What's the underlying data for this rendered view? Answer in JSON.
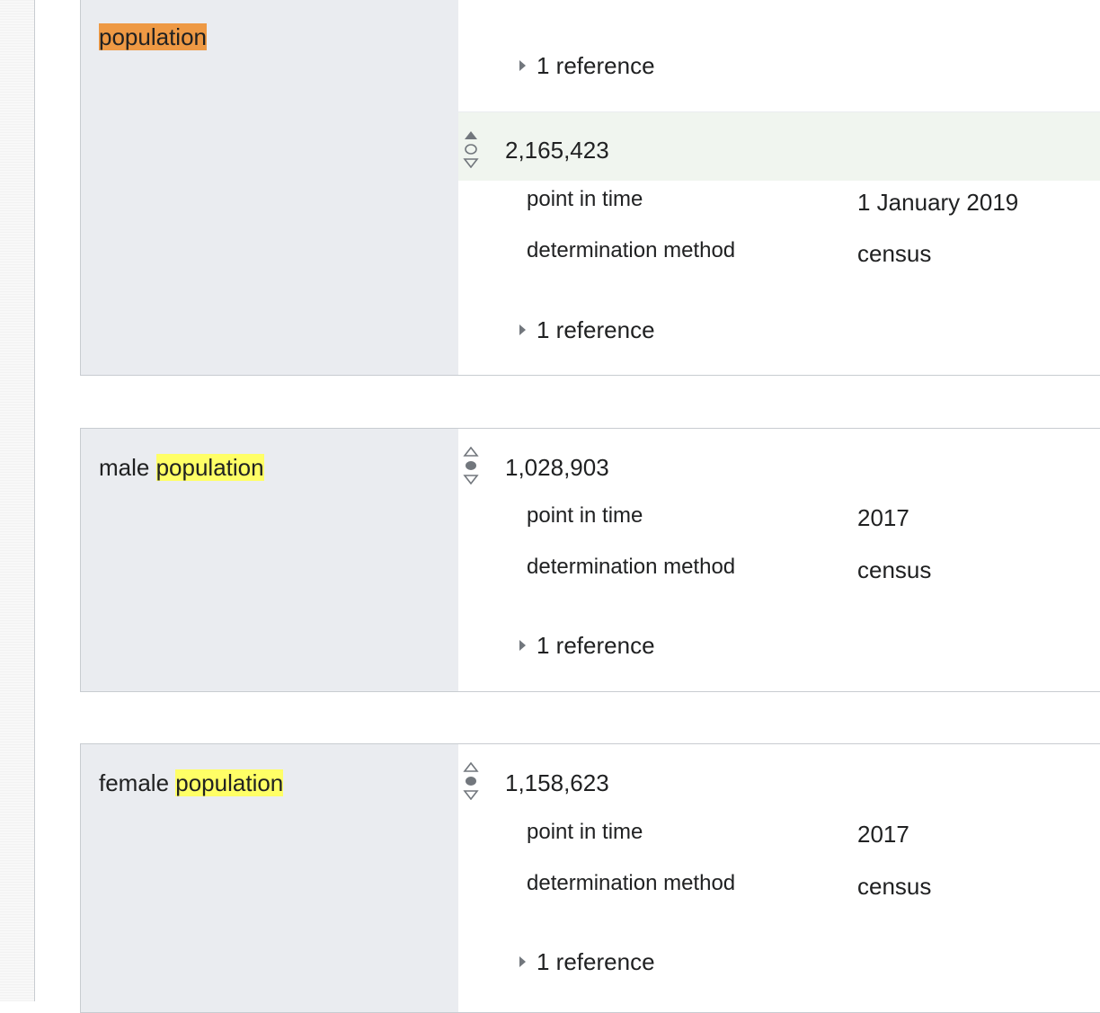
{
  "groups": [
    {
      "property": {
        "prefix": "",
        "highlight": "population",
        "highlight_style": "orange"
      },
      "statements": [
        {
          "references": "1 reference"
        },
        {
          "value": "2,165,423",
          "qualifiers": [
            {
              "property": "point in time",
              "value": "1 January 2019"
            },
            {
              "property": "determination method",
              "value": "census"
            }
          ],
          "references": "1 reference"
        }
      ]
    },
    {
      "property": {
        "prefix": "male ",
        "highlight": "population",
        "highlight_style": "yellow"
      },
      "statements": [
        {
          "value": "1,028,903",
          "qualifiers": [
            {
              "property": "point in time",
              "value": "2017"
            },
            {
              "property": "determination method",
              "value": "census"
            }
          ],
          "references": "1 reference"
        }
      ]
    },
    {
      "property": {
        "prefix": "female ",
        "highlight": "population",
        "highlight_style": "yellow"
      },
      "statements": [
        {
          "value": "1,158,623",
          "qualifiers": [
            {
              "property": "point in time",
              "value": "2017"
            },
            {
              "property": "determination method",
              "value": "census"
            }
          ],
          "references": "1 reference"
        }
      ]
    }
  ],
  "colors": {
    "label_bg": "#eaecf0",
    "border": "#c8ccd1",
    "preferred_highlight": "#f0f5ef",
    "find_match_current": "#ee9944",
    "find_match": "#ffff66",
    "text": "#202122"
  },
  "icons": {
    "rank": "rank-selector-icon",
    "expand": "expand-triangle-icon"
  }
}
